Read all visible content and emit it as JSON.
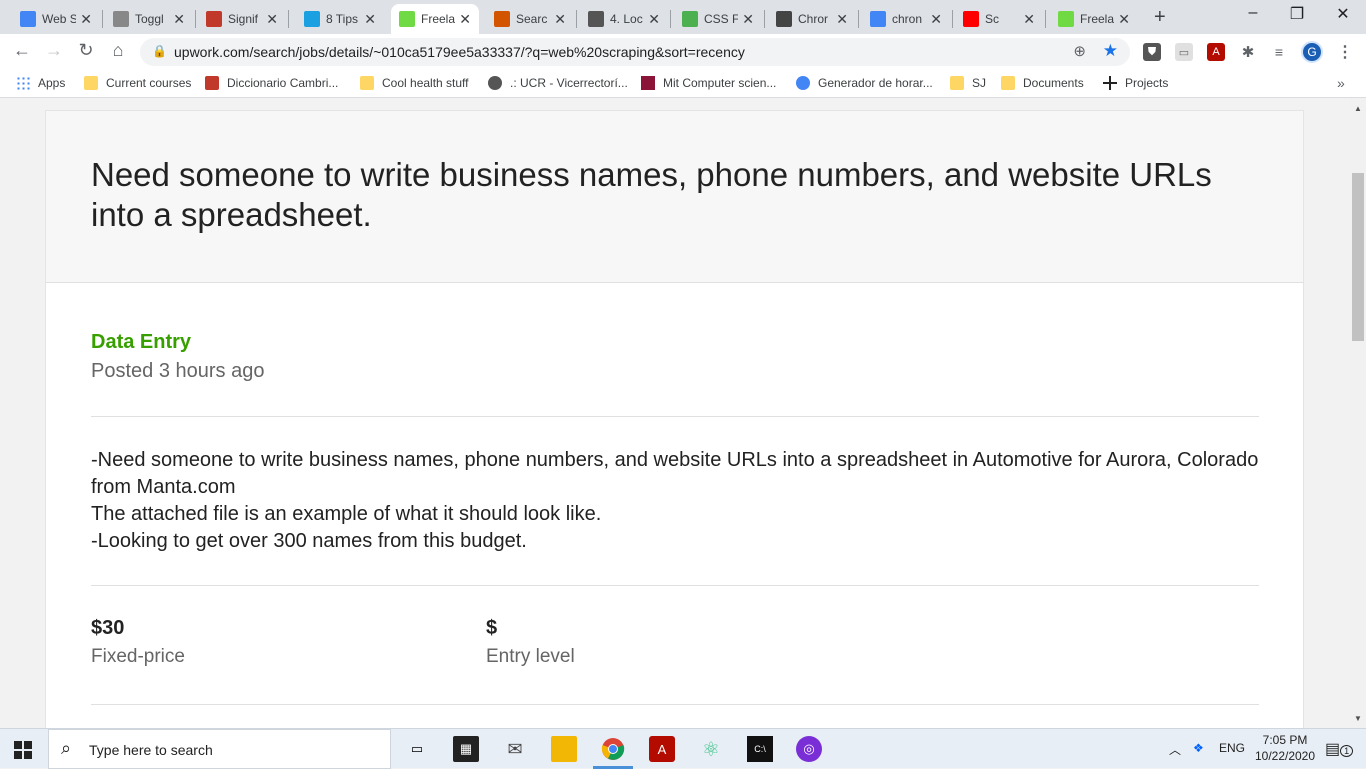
{
  "browser": {
    "tabs": [
      {
        "title": "Web S",
        "favicon": "docs-icon",
        "color": "#4285f4",
        "active": false
      },
      {
        "title": "Toggl",
        "favicon": "toggl-icon",
        "color": "#888888",
        "active": false
      },
      {
        "title": "Signif",
        "favicon": "shield-crest-icon",
        "color": "#c0392b",
        "active": false
      },
      {
        "title": "8 Tips",
        "favicon": "drop-icon",
        "color": "#1ba1e2",
        "active": false
      },
      {
        "title": "Freela",
        "favicon": "upwork-icon",
        "color": "#6fda44",
        "active": true
      },
      {
        "title": "Searc",
        "favicon": "m-icon",
        "color": "#d35400",
        "active": false
      },
      {
        "title": "4. Loc",
        "favicon": "book-icon",
        "color": "#555555",
        "active": false
      },
      {
        "title": "CSS F",
        "favicon": "w3-icon",
        "color": "#4caf50",
        "active": false
      },
      {
        "title": "Chror",
        "favicon": "shield-icon",
        "color": "#444444",
        "active": false
      },
      {
        "title": "chron",
        "favicon": "google-icon",
        "color": "#4285f4",
        "active": false
      },
      {
        "title": "Sc",
        "favicon": "youtube-icon",
        "color": "#ff0000",
        "active": false
      },
      {
        "title": "Freela",
        "favicon": "upwork-icon",
        "color": "#6fda44",
        "active": false
      }
    ],
    "new_tab_label": "+",
    "window_controls": {
      "minimize": "–",
      "restore": "❐",
      "close": "✕"
    },
    "url": "upwork.com/search/jobs/details/~010ca5179ee5a33337/?q=web%20scraping&sort=recency",
    "bookmarks": [
      {
        "label": "Apps",
        "icon": "apps-grid-icon"
      },
      {
        "label": "Current courses",
        "icon": "folder-icon"
      },
      {
        "label": "Diccionario Cambri...",
        "icon": "cambridge-icon"
      },
      {
        "label": "Cool health stuff",
        "icon": "folder-icon"
      },
      {
        "label": ".: UCR - Vicerrectorí...",
        "icon": "globe-icon"
      },
      {
        "label": "Mit Computer scien...",
        "icon": "mit-icon"
      },
      {
        "label": "Generador de horar...",
        "icon": "g-icon"
      },
      {
        "label": "SJ",
        "icon": "folder-icon"
      },
      {
        "label": "Documents",
        "icon": "folder-icon"
      },
      {
        "label": "Projects",
        "icon": "pin-icon"
      }
    ],
    "bookmarks_overflow": "»"
  },
  "job": {
    "title": "Need someone to write business names, phone numbers, and website URLs into a spreadsheet.",
    "category": "Data Entry",
    "posted": "Posted 3 hours ago",
    "description": [
      "-Need someone to write business names, phone numbers, and website URLs into a spreadsheet in Automotive for Aurora, Colorado from Manta.com",
      "The attached file is an example of what it should look like.",
      "-Looking to get over 300 names from this budget."
    ],
    "price": "$30",
    "price_type": "Fixed-price",
    "level_symbol": "$",
    "level": "Entry level"
  },
  "taskbar": {
    "search_placeholder": "Type here to search",
    "language": "ENG",
    "time": "7:05 PM",
    "date": "10/22/2020",
    "notification_count": "1"
  },
  "colors": {
    "accent_green": "#37a000",
    "chrome_blue": "#1a73e8"
  }
}
